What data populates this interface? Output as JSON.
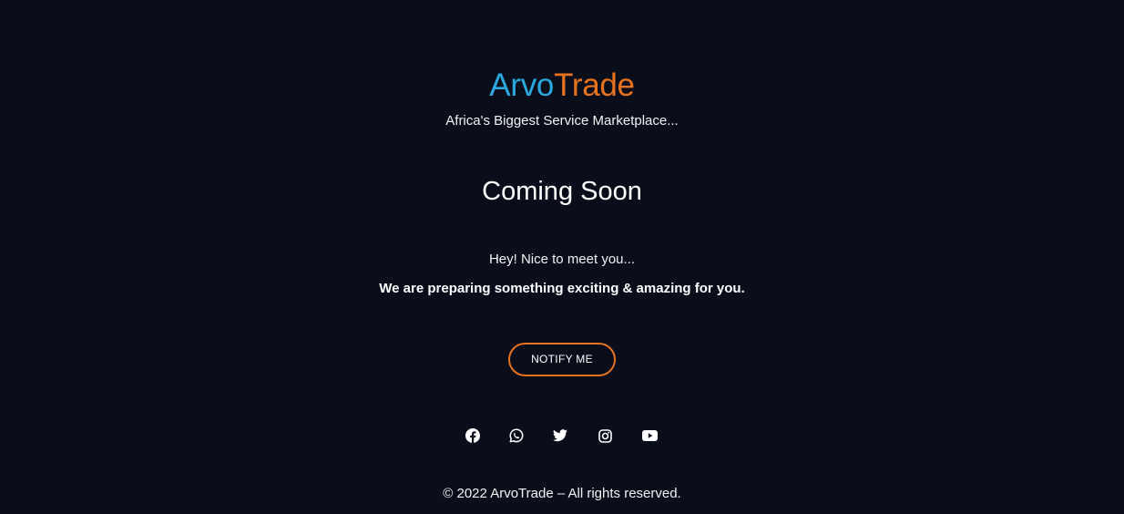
{
  "brand": {
    "name_part1": "Arvo",
    "name_part2": "Trade",
    "tagline": "Africa's Biggest Service Marketplace...",
    "color_part1": "#2ba8e0",
    "color_part2": "#e8731e"
  },
  "main": {
    "headline": "Coming Soon",
    "greeting": "Hey! Nice to meet you...",
    "message": "We are preparing something exciting & amazing for you.",
    "cta_label": "NOTIFY ME"
  },
  "socials": [
    {
      "icon": "facebook-icon"
    },
    {
      "icon": "whatsapp-icon"
    },
    {
      "icon": "twitter-icon"
    },
    {
      "icon": "instagram-icon"
    },
    {
      "icon": "youtube-icon"
    }
  ],
  "footer": {
    "copyright": "© 2022 ArvoTrade – All rights reserved."
  },
  "colors": {
    "background": "#0a0d1a",
    "accent": "#e8731e"
  }
}
